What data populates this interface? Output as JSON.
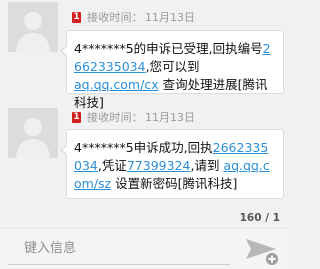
{
  "messages": [
    {
      "sim_badge": "1",
      "received_label": "接收时间：",
      "received_date": "11月13日",
      "body": {
        "t1": "4*******5的申诉已受理,回执编号",
        "receipt_no": "2662335034",
        "t2": ",您可以到",
        "url": "aq.qq.com/cx",
        "t3": " 查询处理进展[腾讯科技]"
      }
    },
    {
      "sim_badge": "1",
      "received_label": "接收时间：",
      "received_date": "11月13日",
      "body": {
        "t1": "4*******5申诉成功,回执",
        "receipt_no": "2662335034",
        "t2": ",凭证",
        "voucher_no": "77399324",
        "t3": ",请到 ",
        "url": "aq.qq.com/sz",
        "t4": " 设置新密码[腾讯科技]"
      }
    }
  ],
  "char_counter": "160 / 1",
  "compose": {
    "placeholder": "键入信息"
  },
  "icons": {
    "avatar": "person-silhouette-icon",
    "send": "send-icon",
    "sim": "sim-badge-icon"
  },
  "colors": {
    "link": "#2b8fd6",
    "sim_badge": "#d21f1f"
  }
}
